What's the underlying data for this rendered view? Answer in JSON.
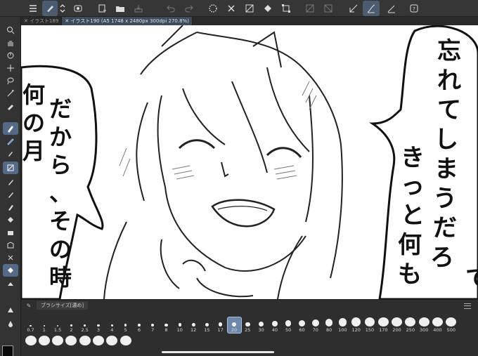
{
  "tabs": [
    {
      "label": "✕ イラスト189",
      "active": false
    },
    {
      "label": "✕ イラスト190 (A5 1748 x 2480px 300dpi 270.8%)",
      "active": true
    }
  ],
  "toolbar_icons": [
    "menu-icon",
    "brush-settings-icon",
    "chevron-updown-icon",
    "camera-record-icon",
    "new-canvas-icon",
    "open-folder-icon",
    "save-icon",
    "undo-icon",
    "redo-icon",
    "loading-spinner-icon",
    "delete-icon",
    "clear-layer-icon",
    "fill-icon",
    "transform-icon",
    "pattern-icon",
    "shape-icon",
    "correct-line-icon",
    "stabilizer-icon",
    "vector-brush-icon",
    "help-icon"
  ],
  "left_tools": [
    "zoom-icon",
    "hand-icon",
    "rotate-icon",
    "move-layer-icon",
    "lasso-icon",
    "magic-wand-icon",
    "eyedropper-icon",
    "pen-icon",
    "pencil-icon",
    "brush-icon",
    "airbrush-icon",
    "decoration-icon",
    "eraser-icon",
    "blend-icon",
    "fill-icon",
    "gradient-icon",
    "figure-icon",
    "frame-icon",
    "ruler-icon",
    "text-icon",
    "balloon-icon"
  ],
  "canvas_text": {
    "balloon_right": [
      "忘",
      "れ",
      "て",
      "し",
      "ま",
      "う",
      "だ",
      "ろ"
    ],
    "balloon_right_col2": [
      "き",
      "っ",
      "と",
      "何",
      "も"
    ],
    "balloon_left": [
      "だ",
      "か",
      "ら",
      "、",
      "そ",
      "の",
      "時"
    ],
    "balloon_left_col2": [
      "何",
      "の",
      "月"
    ],
    "edge_right": "て"
  },
  "brush_panel": {
    "tab_label": "ブラシサイズ[濃め]",
    "sizes_row1": [
      "0.7",
      "1",
      "1.5",
      "2",
      "2.5",
      "3",
      "4",
      "5",
      "6",
      "7",
      "8",
      "10",
      "12",
      "15",
      "17",
      "20",
      "25",
      "30",
      "40",
      "50",
      "60",
      "70",
      "80",
      "100",
      "120",
      "150",
      "170",
      "200",
      "250",
      "300",
      "400",
      "500"
    ],
    "selected_size": "20",
    "sizes_row2_count": 8
  },
  "colors": {
    "accent": "#6d88aa",
    "main_color": "#0a0a0a",
    "sub_color": "#ffffff"
  }
}
